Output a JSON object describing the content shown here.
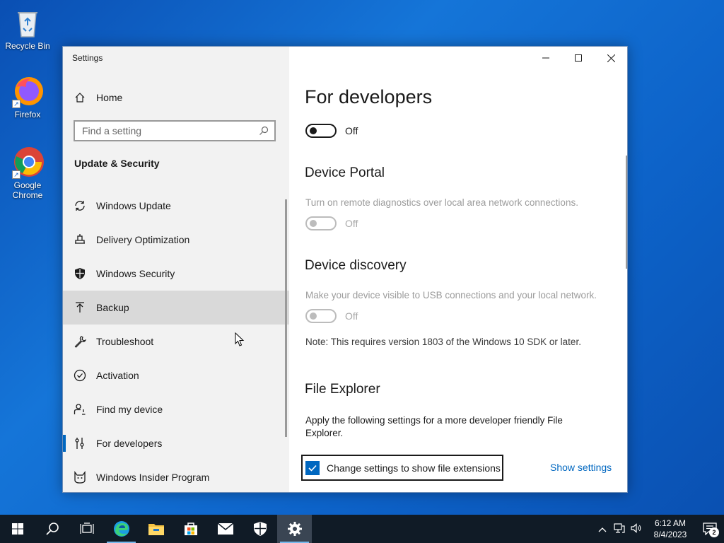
{
  "desktop": {
    "icons": [
      {
        "label": "Recycle Bin"
      },
      {
        "label": "Firefox"
      },
      {
        "label": "Google Chrome"
      }
    ]
  },
  "window": {
    "title": "Settings",
    "controls": {
      "minimize": "minimize-icon",
      "maximize": "maximize-icon",
      "close": "close-icon"
    }
  },
  "sidebar": {
    "home_label": "Home",
    "search_placeholder": "Find a setting",
    "section_title": "Update & Security",
    "items": [
      {
        "label": "Windows Update",
        "icon": "refresh-icon"
      },
      {
        "label": "Delivery Optimization",
        "icon": "delivery-optimization-icon"
      },
      {
        "label": "Windows Security",
        "icon": "shield-icon"
      },
      {
        "label": "Backup",
        "icon": "backup-arrow-icon",
        "state": "hover"
      },
      {
        "label": "Troubleshoot",
        "icon": "wrench-icon"
      },
      {
        "label": "Activation",
        "icon": "check-circle-icon"
      },
      {
        "label": "Find my device",
        "icon": "person-location-icon"
      },
      {
        "label": "For developers",
        "icon": "developer-tools-icon",
        "state": "selected"
      },
      {
        "label": "Windows Insider Program",
        "icon": "insider-cat-icon"
      }
    ]
  },
  "content": {
    "page_title": "For developers",
    "dev_mode": {
      "state": "Off",
      "on": false
    },
    "device_portal": {
      "title": "Device Portal",
      "description": "Turn on remote diagnostics over local area network connections.",
      "state": "Off",
      "enabled": false
    },
    "device_discovery": {
      "title": "Device discovery",
      "description": "Make your device visible to USB connections and your local network.",
      "state": "Off",
      "enabled": false,
      "note": "Note: This requires version 1803 of the Windows 10 SDK or later."
    },
    "file_explorer": {
      "title": "File Explorer",
      "description": "Apply the following settings for a more developer friendly File Explorer.",
      "checkbox_label": "Change settings to show file extensions",
      "checked": true,
      "link_label": "Show settings"
    }
  },
  "taskbar": {
    "items": [
      {
        "icon": "windows-start-icon"
      },
      {
        "icon": "search-icon"
      },
      {
        "icon": "task-view-icon"
      },
      {
        "icon": "edge-icon",
        "state": "running"
      },
      {
        "icon": "file-explorer-icon"
      },
      {
        "icon": "store-icon"
      },
      {
        "icon": "mail-icon"
      },
      {
        "icon": "security-shield-icon"
      },
      {
        "icon": "settings-gear-icon",
        "state": "active"
      }
    ],
    "clock": {
      "time": "6:12 AM",
      "date": "8/4/2023"
    },
    "notification_count": "2"
  },
  "colors": {
    "accent": "#0067c0",
    "sidebar_bg": "#f2f2f2",
    "taskbar_bg": "#101b26"
  }
}
